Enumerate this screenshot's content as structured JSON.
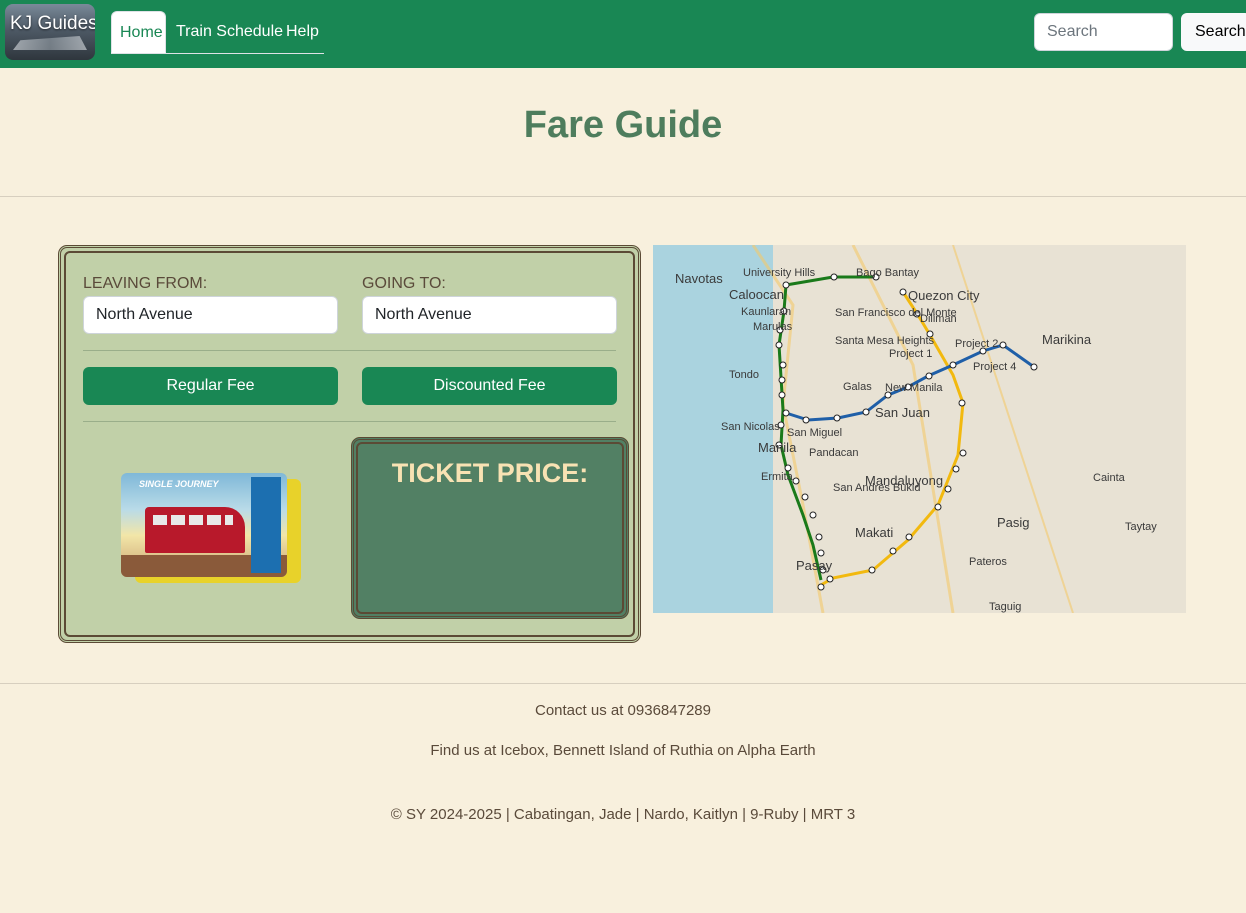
{
  "navbar": {
    "brand": "KJ Guides",
    "tabs": [
      {
        "label": "Home"
      },
      {
        "label": "Train Schedule"
      },
      {
        "label": "Help"
      }
    ],
    "search_placeholder": "Search",
    "search_button": "Search"
  },
  "page": {
    "title": "Fare Guide"
  },
  "fare_form": {
    "leaving_label": "LEAVING FROM:",
    "leaving_value": "North Avenue",
    "going_label": "GOING TO:",
    "going_value": "North Avenue",
    "regular_button": "Regular Fee",
    "discounted_button": "Discounted Fee",
    "ticket_price_label": "TICKET PRICE:",
    "ticket_price_value": ""
  },
  "ticket_card": {
    "caption": "SINGLE JOURNEY"
  },
  "map": {
    "labels": [
      "Navotas",
      "Caloocan",
      "Quezon City",
      "Marikina",
      "Manila",
      "San Juan",
      "Mandaluyong",
      "Pasig",
      "Makati",
      "Pasay",
      "Cainta",
      "Taytay",
      "Pateros",
      "Taguig",
      "Tondo",
      "San Nicolas",
      "Galas",
      "Diliman",
      "Project 4",
      "Project 1",
      "Ermita",
      "Pandacan",
      "San Miguel",
      "Bago Bantay",
      "University Hills",
      "Kaunlaran",
      "Marulas",
      "San Francisco del Monte",
      "Santa Mesa Heights",
      "San Andres Bukid",
      "New Manila",
      "Project 2"
    ],
    "lines": {
      "green": "#1a7a1a",
      "yellow": "#f2b90f",
      "blue": "#1f5fa8"
    }
  },
  "footer": {
    "contact": "Contact us at 0936847289",
    "address": "Find us at Icebox, Bennett Island of Ruthia on Alpha Earth",
    "copyright": "© SY 2024-2025 | Cabatingan, Jade | Nardo, Kaitlyn | 9-Ruby | MRT 3"
  }
}
